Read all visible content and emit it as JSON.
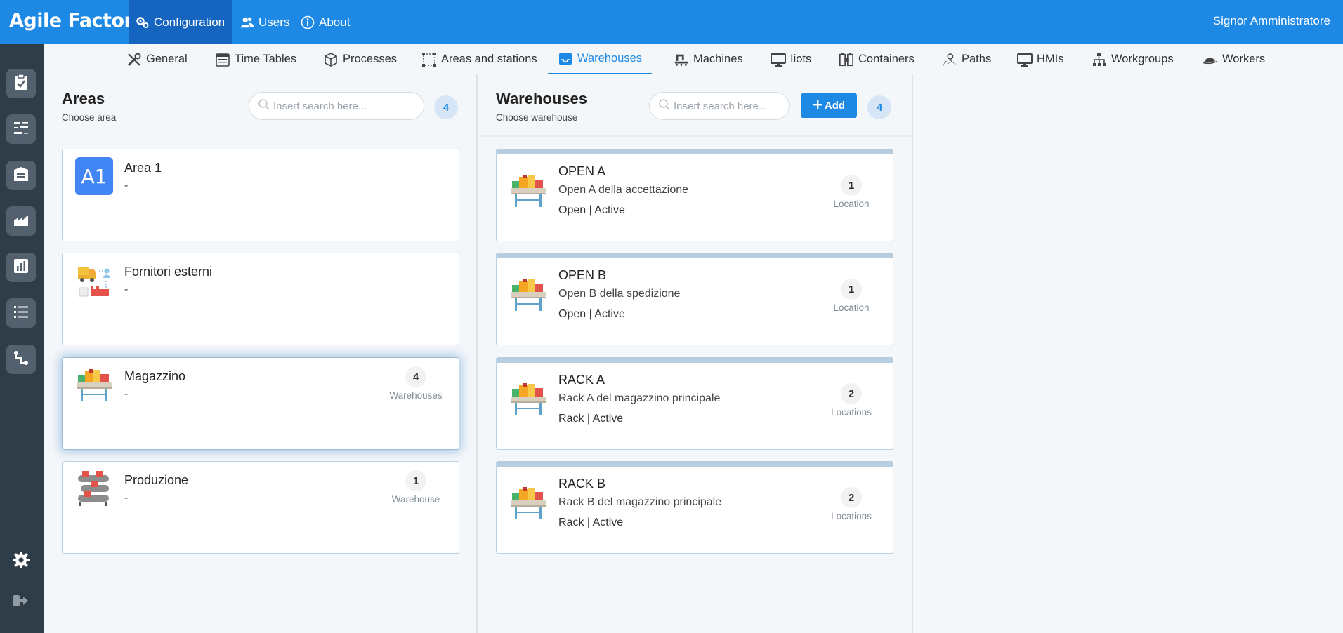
{
  "app": {
    "brand": "Agile Factory",
    "user": "Signor Amministratore"
  },
  "topnav": [
    {
      "label": "Configuration",
      "icon": "gears-icon",
      "active": true
    },
    {
      "label": "Users",
      "icon": "users-icon",
      "active": false
    },
    {
      "label": "About",
      "icon": "info-icon",
      "active": false
    }
  ],
  "sidebar": {
    "items": [
      "clipboard-check-icon",
      "sliders-icon",
      "warehouse-icon",
      "area-chart-icon",
      "bar-chart-icon",
      "list-icon",
      "flow-icon"
    ],
    "settings_icon": "gear-icon",
    "logout_icon": "sign-out-icon"
  },
  "subnav": [
    {
      "label": "General",
      "icon": "tools-icon"
    },
    {
      "label": "Time Tables",
      "icon": "calendar-icon"
    },
    {
      "label": "Processes",
      "icon": "cube-icon"
    },
    {
      "label": "Areas and stations",
      "icon": "area-select-icon"
    },
    {
      "label": "Warehouses",
      "icon": "inbox-icon",
      "active": true
    },
    {
      "label": "Machines",
      "icon": "machine-icon"
    },
    {
      "label": "Iiots",
      "icon": "monitor-icon"
    },
    {
      "label": "Containers",
      "icon": "containers-icon"
    },
    {
      "label": "Paths",
      "icon": "path-icon"
    },
    {
      "label": "HMIs",
      "icon": "hmi-monitor-icon"
    },
    {
      "label": "Workgroups",
      "icon": "workgroups-icon"
    },
    {
      "label": "Workers",
      "icon": "helmet-icon"
    }
  ],
  "areas": {
    "title": "Areas",
    "subtitle": "Choose area",
    "search_placeholder": "Insert search here...",
    "count": "4",
    "items": [
      {
        "name": "Area 1",
        "desc": "-",
        "icon": "a1-badge-icon",
        "badge": "A1"
      },
      {
        "name": "Fornitori esterni",
        "desc": "-",
        "icon": "supplier-truck-icon"
      },
      {
        "name": "Magazzino",
        "desc": "-",
        "icon": "warehouse-shelf-icon",
        "count": "4",
        "count_label": "Warehouses",
        "selected": true
      },
      {
        "name": "Produzione",
        "desc": "-",
        "icon": "production-conveyor-icon",
        "count": "1",
        "count_label": "Warehouse"
      }
    ]
  },
  "warehouses": {
    "title": "Warehouses",
    "subtitle": "Choose warehouse",
    "search_placeholder": "Insert search here...",
    "add_label": "Add",
    "count": "4",
    "items": [
      {
        "name": "OPEN A",
        "desc": "Open A della accettazione",
        "status": "Open | Active",
        "count": "1",
        "count_label": "Location"
      },
      {
        "name": "OPEN B",
        "desc": "Open B della spedizione",
        "status": "Open | Active",
        "count": "1",
        "count_label": "Location"
      },
      {
        "name": "RACK A",
        "desc": "Rack A del magazzino principale",
        "status": "Rack | Active",
        "count": "2",
        "count_label": "Locations"
      },
      {
        "name": "RACK B",
        "desc": "Rack B del magazzino principale",
        "status": "Rack | Active",
        "count": "2",
        "count_label": "Locations"
      }
    ]
  },
  "colors": {
    "topbar": "#1e88e5",
    "sidebar": "#2f3d48",
    "accent": "#1e88e5"
  }
}
